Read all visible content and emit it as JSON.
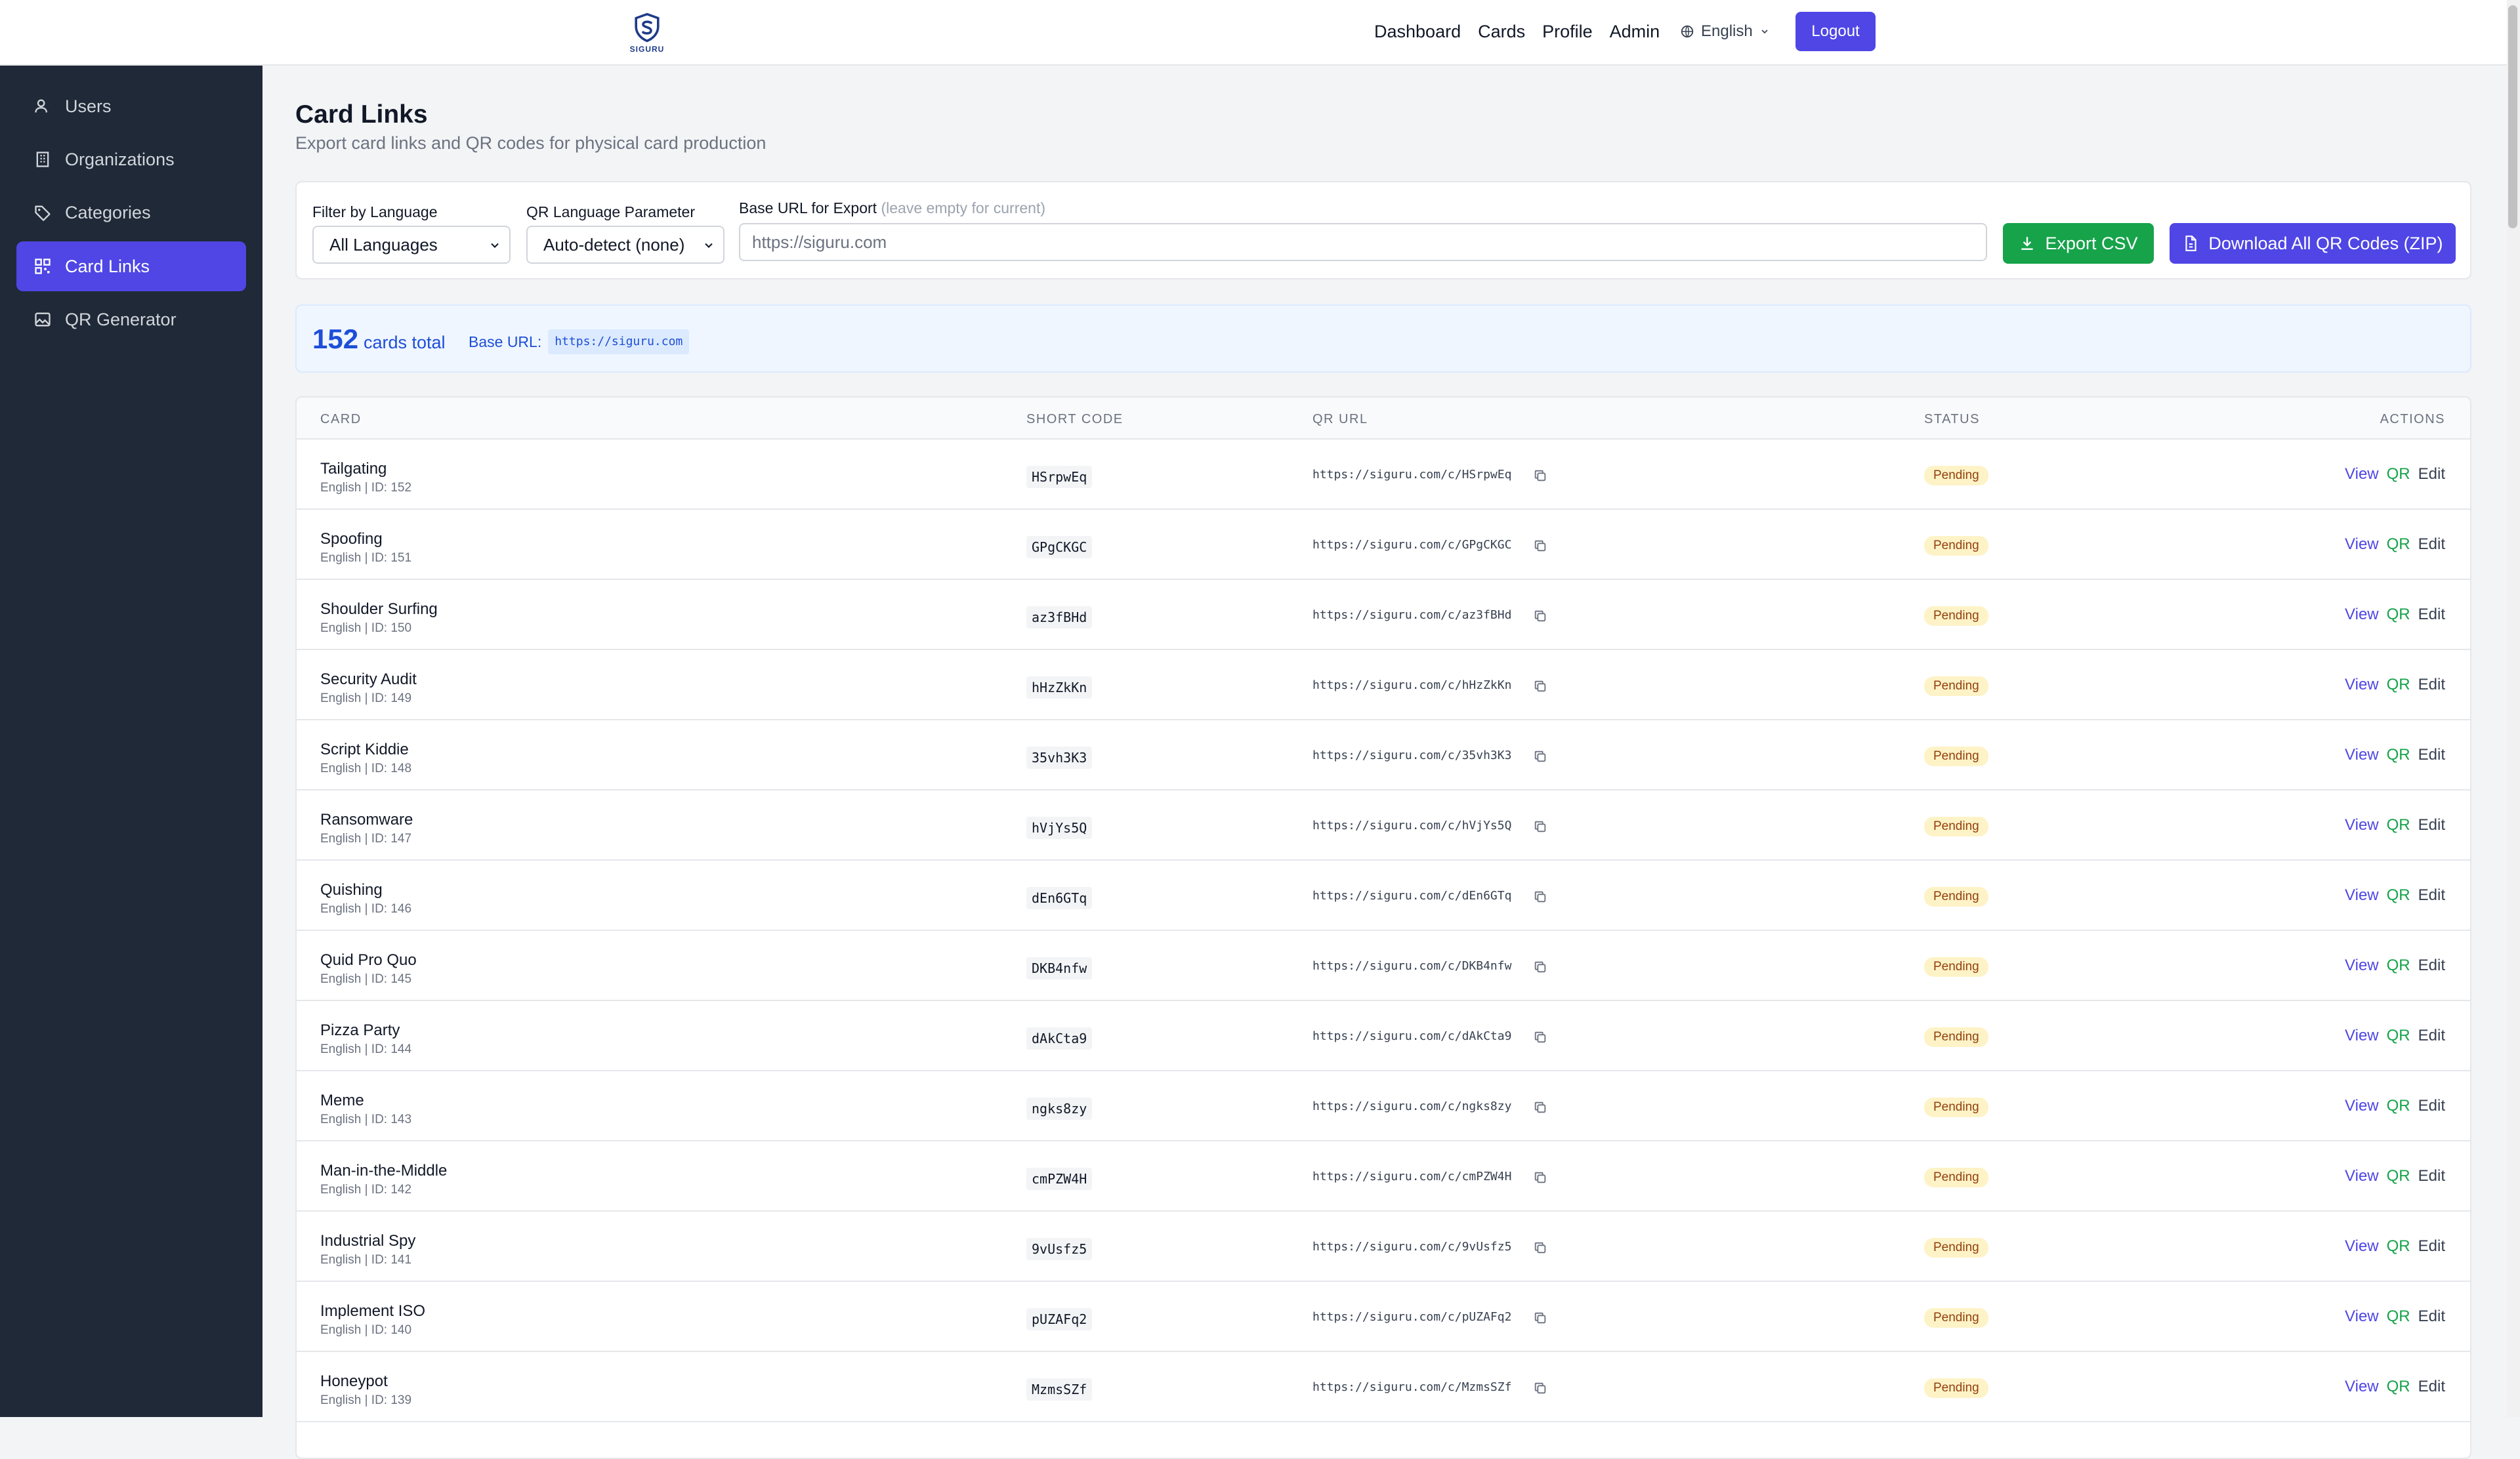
{
  "brand": {
    "name": "SIGURU"
  },
  "nav": {
    "links": [
      "Dashboard",
      "Cards",
      "Profile",
      "Admin"
    ],
    "language": "English",
    "logout": "Logout"
  },
  "sidebar": {
    "items": [
      {
        "label": "Users",
        "icon": "users-icon"
      },
      {
        "label": "Organizations",
        "icon": "building-icon"
      },
      {
        "label": "Categories",
        "icon": "tag-icon"
      },
      {
        "label": "Card Links",
        "icon": "qr-grid-icon",
        "active": true
      },
      {
        "label": "QR Generator",
        "icon": "image-icon"
      }
    ]
  },
  "page": {
    "title": "Card Links",
    "subtitle": "Export card links and QR codes for physical card production"
  },
  "filters": {
    "language_label": "Filter by Language",
    "language_value": "All Languages",
    "qr_param_label": "QR Language Parameter",
    "qr_param_value": "Auto-detect (none)",
    "base_url_label": "Base URL for Export",
    "base_url_hint": "(leave empty for current)",
    "base_url_placeholder": "https://siguru.com",
    "export_csv": "Export CSV",
    "download_zip": "Download All QR Codes (ZIP)"
  },
  "summary": {
    "count": "152",
    "count_label": "cards total",
    "base_url_label": "Base URL:",
    "base_url": "https://siguru.com"
  },
  "table": {
    "headers": [
      "CARD",
      "SHORT CODE",
      "QR URL",
      "STATUS",
      "ACTIONS"
    ],
    "actions": {
      "view": "View",
      "qr": "QR",
      "edit": "Edit"
    },
    "rows": [
      {
        "title": "Tailgating",
        "meta": "English | ID: 152",
        "code": "HSrpwEq",
        "url": "https://siguru.com/c/HSrpwEq",
        "status": "Pending"
      },
      {
        "title": "Spoofing",
        "meta": "English | ID: 151",
        "code": "GPgCKGC",
        "url": "https://siguru.com/c/GPgCKGC",
        "status": "Pending"
      },
      {
        "title": "Shoulder Surfing",
        "meta": "English | ID: 150",
        "code": "az3fBHd",
        "url": "https://siguru.com/c/az3fBHd",
        "status": "Pending"
      },
      {
        "title": "Security Audit",
        "meta": "English | ID: 149",
        "code": "hHzZkKn",
        "url": "https://siguru.com/c/hHzZkKn",
        "status": "Pending"
      },
      {
        "title": "Script Kiddie",
        "meta": "English | ID: 148",
        "code": "35vh3K3",
        "url": "https://siguru.com/c/35vh3K3",
        "status": "Pending"
      },
      {
        "title": "Ransomware",
        "meta": "English | ID: 147",
        "code": "hVjYs5Q",
        "url": "https://siguru.com/c/hVjYs5Q",
        "status": "Pending"
      },
      {
        "title": "Quishing",
        "meta": "English | ID: 146",
        "code": "dEn6GTq",
        "url": "https://siguru.com/c/dEn6GTq",
        "status": "Pending"
      },
      {
        "title": "Quid Pro Quo",
        "meta": "English | ID: 145",
        "code": "DKB4nfw",
        "url": "https://siguru.com/c/DKB4nfw",
        "status": "Pending"
      },
      {
        "title": "Pizza Party",
        "meta": "English | ID: 144",
        "code": "dAkCta9",
        "url": "https://siguru.com/c/dAkCta9",
        "status": "Pending"
      },
      {
        "title": "Meme",
        "meta": "English | ID: 143",
        "code": "ngks8zy",
        "url": "https://siguru.com/c/ngks8zy",
        "status": "Pending"
      },
      {
        "title": "Man-in-the-Middle",
        "meta": "English | ID: 142",
        "code": "cmPZW4H",
        "url": "https://siguru.com/c/cmPZW4H",
        "status": "Pending"
      },
      {
        "title": "Industrial Spy",
        "meta": "English | ID: 141",
        "code": "9vUsfz5",
        "url": "https://siguru.com/c/9vUsfz5",
        "status": "Pending"
      },
      {
        "title": "Implement ISO",
        "meta": "English | ID: 140",
        "code": "pUZAFq2",
        "url": "https://siguru.com/c/pUZAFq2",
        "status": "Pending"
      },
      {
        "title": "Honeypot",
        "meta": "English | ID: 139",
        "code": "MzmsSZf",
        "url": "https://siguru.com/c/MzmsSZf",
        "status": "Pending"
      }
    ]
  }
}
